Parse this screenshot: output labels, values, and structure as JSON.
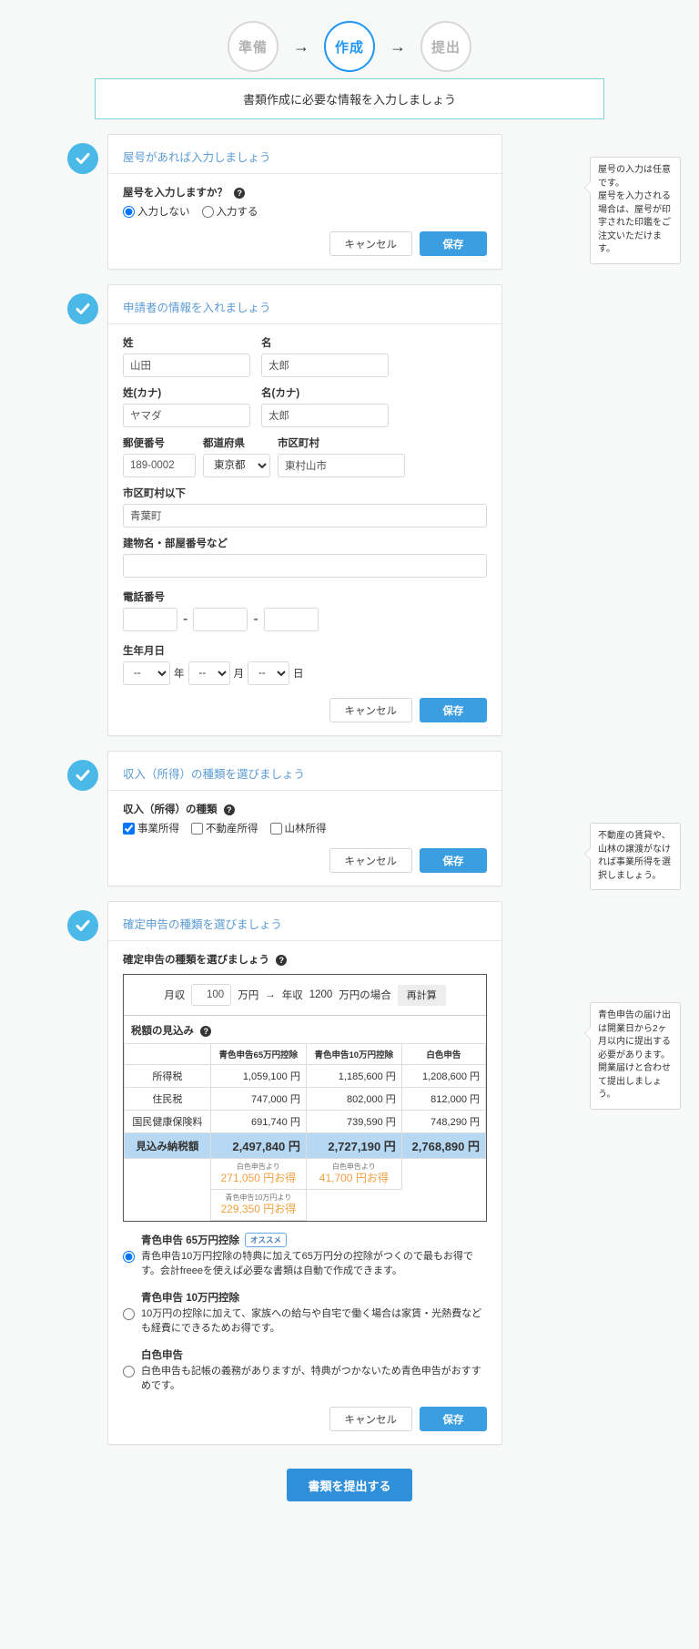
{
  "stepper": {
    "steps": [
      {
        "label": "準備",
        "state": "done"
      },
      {
        "label": "作成",
        "state": "active"
      },
      {
        "label": "提出",
        "state": "todo"
      }
    ],
    "arrow": "→"
  },
  "banner": {
    "text": "書類作成に必要な情報を入力しましょう"
  },
  "buttons": {
    "cancel": "キャンセル",
    "save": "保存",
    "submit": "書類を提出する"
  },
  "sections": {
    "trade_name": {
      "title": "屋号があれば入力しましょう",
      "question": "屋号を入力しますか？",
      "options": [
        {
          "label": "入力しない",
          "checked": true
        },
        {
          "label": "入力する",
          "checked": false
        }
      ],
      "tooltip": "屋号の入力は任意です。\n屋号を入力される場合は、屋号が印字された印鑑をご注文いただけます。"
    },
    "applicant": {
      "title": "申請者の情報を入れましょう",
      "fields": {
        "last_name_label": "姓",
        "last_name_value": "山田",
        "first_name_label": "名",
        "first_name_value": "太郎",
        "last_kana_label": "姓(カナ)",
        "last_kana_value": "ヤマダ",
        "first_kana_label": "名(カナ)",
        "first_kana_value": "太郎",
        "postal_label": "郵便番号",
        "postal_value": "189-0002",
        "pref_label": "都道府県",
        "pref_value": "東京都",
        "city_label": "市区町村",
        "city_value": "東村山市",
        "address_label": "市区町村以下",
        "address_value": "青葉町",
        "building_label": "建物名・部屋番号など",
        "building_value": "",
        "phone_label": "電話番号",
        "phone1": "",
        "phone2": "",
        "phone3": "",
        "phone_sep": "-",
        "birth_label": "生年月日",
        "birth_year": "--",
        "birth_month": "--",
        "birth_day": "--",
        "year_unit": "年",
        "month_unit": "月",
        "day_unit": "日"
      }
    },
    "income_type": {
      "title": "収入（所得）の種類を選びましょう",
      "question": "収入（所得）の種類",
      "options": [
        {
          "label": "事業所得",
          "checked": true
        },
        {
          "label": "不動産所得",
          "checked": false
        },
        {
          "label": "山林所得",
          "checked": false
        }
      ],
      "tooltip": "不動産の賃貸や、山林の譲渡がなければ事業所得を選択しましょう。"
    },
    "declaration": {
      "title": "確定申告の種類を選びましょう",
      "question": "確定申告の種類を選びましょう",
      "tooltip": "青色申告の届け出は開業日から2ヶ月以内に提出する必要があります。開業届けと合わせて提出しましょう。",
      "calculator": {
        "monthly_label": "月収",
        "monthly_value": "100",
        "unit_man": "万円",
        "arrow": "→",
        "annual_prefix": "年収",
        "annual_value": "1200",
        "annual_suffix": "万円の場合",
        "recalc_label": "再計算",
        "estimate_label": "税額の見込み"
      },
      "options": [
        {
          "title": "青色申告 65万円控除",
          "badge": "オススメ",
          "checked": true,
          "desc": "青色申告10万円控除の特典に加えて65万円分の控除がつくので最もお得です。会計freeeを使えば必要な書類は自動で作成できます。"
        },
        {
          "title": "青色申告 10万円控除",
          "badge": "",
          "checked": false,
          "desc": "10万円の控除に加えて、家族への給与や自宅で働く場合は家賃・光熱費なども経費にできるためお得です。"
        },
        {
          "title": "白色申告",
          "badge": "",
          "checked": false,
          "desc": "白色申告も記帳の義務がありますが、特典がつかないため青色申告がおすすめです。"
        }
      ]
    }
  },
  "chart_data": {
    "type": "table",
    "title": "税額の見込み",
    "columns": [
      "青色申告65万円控除",
      "青色申告10万円控除",
      "白色申告"
    ],
    "rows": [
      {
        "label": "所得税",
        "values": [
          "1,059,100 円",
          "1,185,600 円",
          "1,208,600 円"
        ]
      },
      {
        "label": "住民税",
        "values": [
          "747,000 円",
          "802,000 円",
          "812,000 円"
        ]
      },
      {
        "label": "国民健康保険料",
        "values": [
          "691,740 円",
          "739,590 円",
          "748,290 円"
        ]
      },
      {
        "label": "見込み納税額",
        "values": [
          "2,497,840 円",
          "2,727,190 円",
          "2,768,890 円"
        ],
        "highlight": true
      }
    ],
    "savings_row_1": [
      {
        "note": "白色申告より",
        "amount": "271,050 円お得"
      },
      {
        "note": "白色申告より",
        "amount": "41,700 円お得"
      },
      {
        "note": "",
        "amount": ""
      }
    ],
    "savings_row_2": [
      {
        "note": "青色申告10万円より",
        "amount": "229,350 円お得"
      },
      {
        "note": "",
        "amount": ""
      },
      {
        "note": "",
        "amount": ""
      }
    ],
    "highlight_color": "#b7d8f2",
    "savings_color": "#f0a040"
  }
}
